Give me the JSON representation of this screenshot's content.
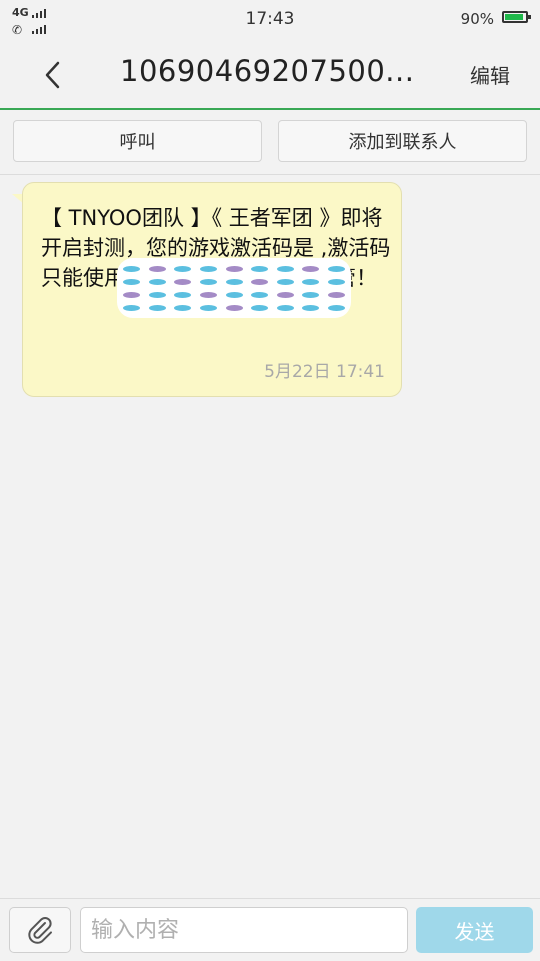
{
  "status_bar": {
    "network": "4G",
    "time": "17:43",
    "battery_text": "90%",
    "battery_level": 0.9,
    "battery_color": "#1fb84a"
  },
  "header": {
    "back_icon": "chevron-left-icon",
    "title": "10690469207500...",
    "edit_label": "编辑",
    "accent_color": "#39a855"
  },
  "actions": {
    "call_label": "呼叫",
    "add_contact_label": "添加到联系人"
  },
  "message": {
    "text": "【 TNYOO团队 】《 王者军团 》即将开启封测，您的游戏激活码是                    ,激活码只能使用一次，请您务必妥善保管！",
    "time": "5月22日 17:41",
    "bubble_color": "#fbf8c7"
  },
  "composer": {
    "attach_icon": "paperclip-icon",
    "input_placeholder": "输入内容",
    "send_label": "发送",
    "send_color": "#9fd8ea"
  }
}
